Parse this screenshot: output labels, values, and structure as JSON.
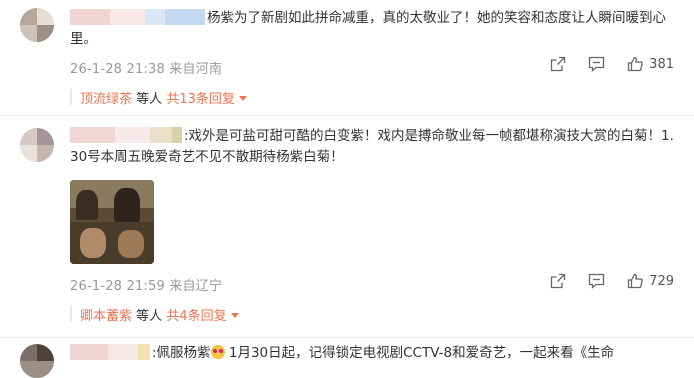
{
  "comments": [
    {
      "text": "杨紫为了新剧如此拼命减重，真的太敬业了！她的笑容和态度让人瞬间暖到心里。",
      "time": "26-1-28 21:38 来自河南",
      "likes": "381",
      "reply_name": "顶流绿茶",
      "reply_etc": "等人",
      "reply_count": "共13条回复"
    },
    {
      "text": ":戏外是可盐可甜可酷的白变紫！戏内是搏命敬业每一帧都堪称演技大赏的白菊！1.30号本周五晚爱奇艺不见不散期待杨紫白菊！",
      "time": "26-1-28 21:59 来自辽宁",
      "likes": "729",
      "reply_name": "卿本蓄紫",
      "reply_etc": "等人",
      "reply_count": "共4条回复"
    },
    {
      "text_a": ":佩服杨紫",
      "text_b": " 1月30日起，记得锁定电视剧CCTV-8和爱奇艺，一起来看《生命"
    }
  ],
  "icons": {
    "share": "share-icon",
    "comment": "comment-icon",
    "like": "thumbs-up-icon",
    "caret": "caret-down-icon",
    "emoji": "heart-eyes-emoji-icon"
  },
  "colors": {
    "accent": "#eb7350",
    "meta": "#999999",
    "text": "#333333"
  }
}
